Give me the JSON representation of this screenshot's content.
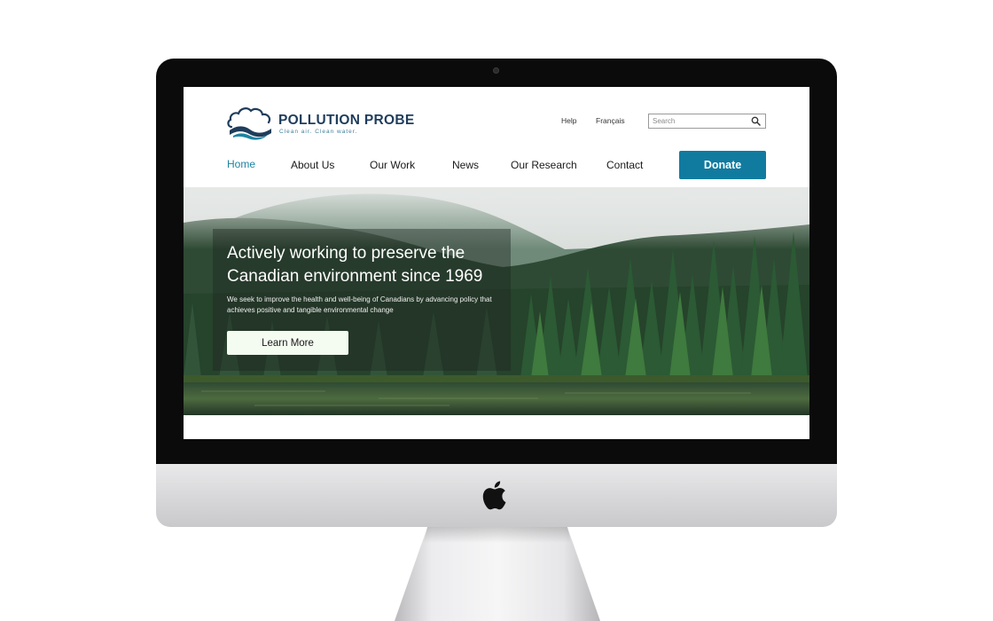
{
  "site": {
    "brand_name": "POLLUTION PROBE",
    "tagline": "Clean air. Clean water.",
    "colors": {
      "brand_navy": "#1f3d5c",
      "accent_teal": "#117b9f",
      "active_link": "#1b84a4"
    }
  },
  "utility_nav": {
    "help_label": "Help",
    "language_label": "Français",
    "search": {
      "placeholder": "Search",
      "value": "",
      "icon": "search-icon"
    }
  },
  "main_nav": {
    "items": [
      {
        "label": "Home",
        "active": true
      },
      {
        "label": "About Us",
        "active": false
      },
      {
        "label": "Our Work",
        "active": false
      },
      {
        "label": "News",
        "active": false
      },
      {
        "label": "Our Research",
        "active": false
      },
      {
        "label": "Contact",
        "active": false
      }
    ],
    "donate_label": "Donate"
  },
  "hero": {
    "title": "Actively working to preserve the Canadian environment since 1969",
    "subtitle": "We seek to improve the health and well-being of Canadians by advancing policy that achieves positive and tangible environmental change",
    "cta_label": "Learn More"
  }
}
